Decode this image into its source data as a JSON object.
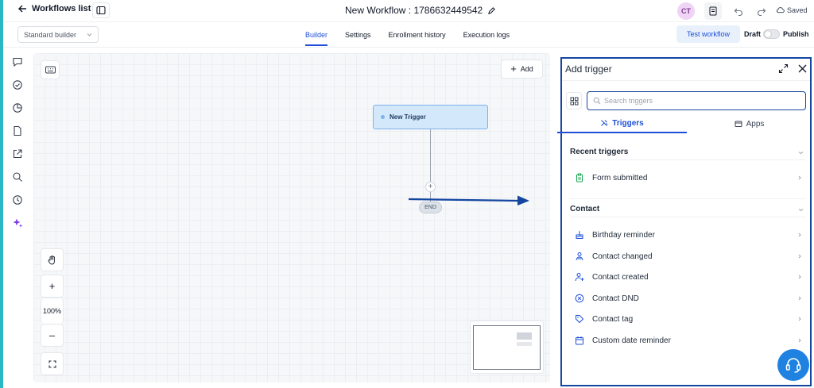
{
  "colors": {
    "accent": "#1d4ed8",
    "panel_border": "#1446a0",
    "node_fill": "#d3e8fb",
    "help": "#1f82e0",
    "left_strip": "#2bb7c5"
  },
  "topbar": {
    "back_label": "Workflows list",
    "workflow_title": "New Workflow : 1786632449542",
    "avatar_initials": "CT",
    "saved_label": "Saved"
  },
  "subbar": {
    "builder_select": "Standard builder",
    "tabs": [
      {
        "label": "Builder",
        "active": true
      },
      {
        "label": "Settings",
        "active": false
      },
      {
        "label": "Enrollment history",
        "active": false
      },
      {
        "label": "Execution logs",
        "active": false
      }
    ],
    "test_button": "Test workflow",
    "draft_label": "Draft",
    "publish_label": "Publish"
  },
  "rail_icons": [
    "chat-icon",
    "check-circle-icon",
    "chart-pie-icon",
    "document-icon",
    "external-link-icon",
    "search-icon",
    "history-icon",
    "sparkle-icon"
  ],
  "canvas": {
    "add_label": "Add",
    "trigger_node_label": "New Trigger",
    "end_label": "END",
    "zoom_label": "100%"
  },
  "panel": {
    "title": "Add trigger",
    "search_placeholder": "Search triggers",
    "tabs": {
      "triggers": "Triggers",
      "apps": "Apps"
    },
    "recent": {
      "heading": "Recent triggers",
      "items": [
        {
          "label": "Form submitted",
          "icon": "clipboard-icon"
        }
      ]
    },
    "contact": {
      "heading": "Contact",
      "items": [
        {
          "label": "Birthday reminder",
          "icon": "cake-icon"
        },
        {
          "label": "Contact changed",
          "icon": "users-icon"
        },
        {
          "label": "Contact created",
          "icon": "user-plus-icon"
        },
        {
          "label": "Contact DND",
          "icon": "block-icon"
        },
        {
          "label": "Contact tag",
          "icon": "tag-icon"
        },
        {
          "label": "Custom date reminder",
          "icon": "calendar-icon"
        }
      ]
    }
  }
}
